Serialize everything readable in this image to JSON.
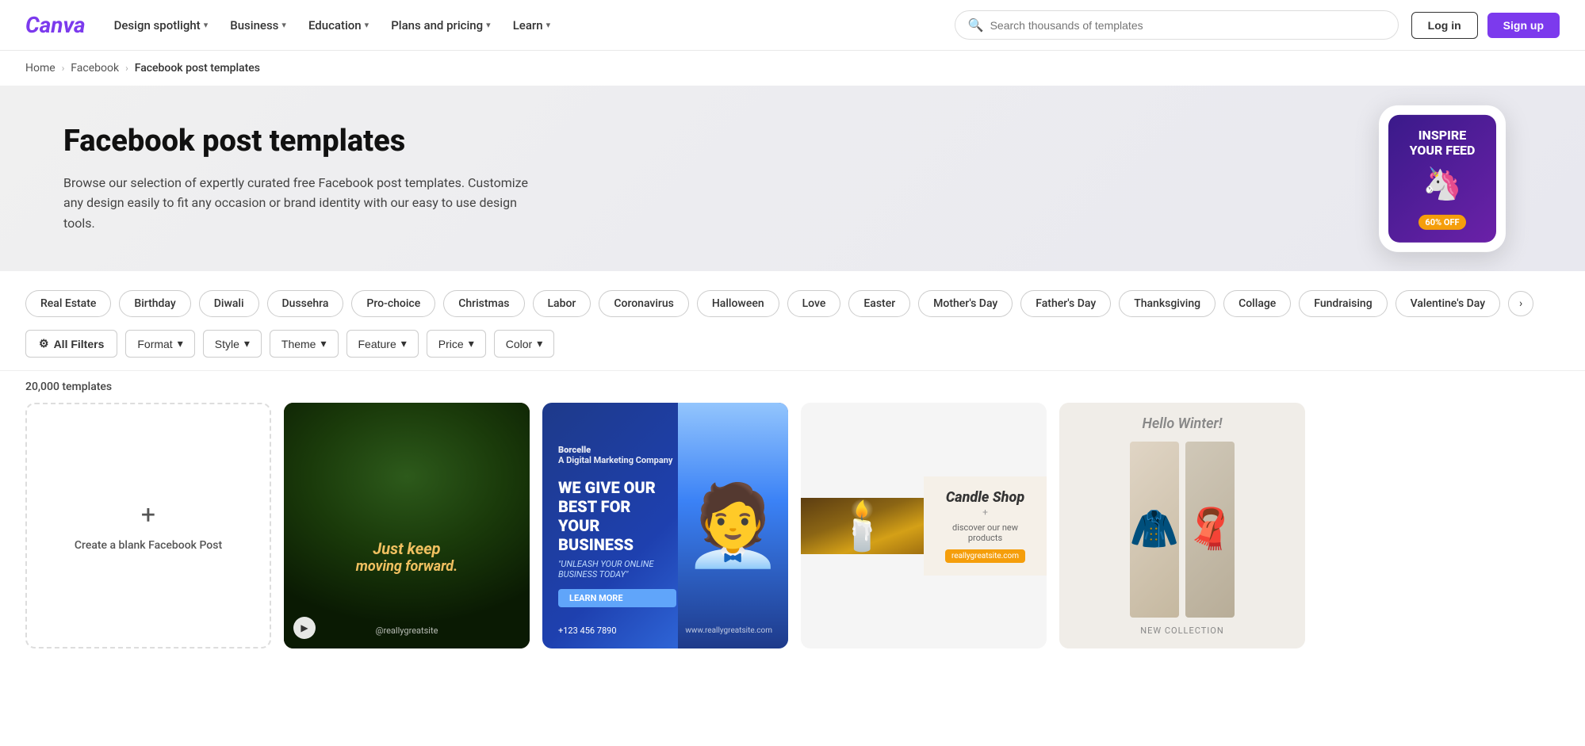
{
  "brand": {
    "name": "Canva",
    "logo_text": "Canva"
  },
  "navbar": {
    "links": [
      {
        "label": "Design spotlight",
        "id": "design-spotlight"
      },
      {
        "label": "Business",
        "id": "business"
      },
      {
        "label": "Education",
        "id": "education"
      },
      {
        "label": "Plans and pricing",
        "id": "plans-pricing"
      },
      {
        "label": "Learn",
        "id": "learn"
      }
    ],
    "search_placeholder": "Search thousands of templates",
    "login_label": "Log in",
    "signup_label": "Sign up"
  },
  "breadcrumb": {
    "items": [
      "Home",
      "Facebook",
      "Facebook post templates"
    ]
  },
  "hero": {
    "title": "Facebook post templates",
    "description": "Browse our selection of expertly curated free Facebook post templates. Customize any design easily to fit any occasion or brand identity with our easy to use design tools.",
    "phone_title": "INSPIRE YOUR FEED",
    "phone_badge": "60% OFF"
  },
  "tags": [
    "Real Estate",
    "Birthday",
    "Diwali",
    "Dussehra",
    "Pro-choice",
    "Christmas",
    "Labor",
    "Coronavirus",
    "Halloween",
    "Love",
    "Easter",
    "Mother's Day",
    "Father's Day",
    "Thanksgiving",
    "Collage",
    "Fundraising",
    "Valentine's Day"
  ],
  "filters": {
    "all_filters_label": "All Filters",
    "buttons": [
      "Format",
      "Style",
      "Theme",
      "Feature",
      "Price",
      "Color"
    ]
  },
  "templates_count": "20,000 templates",
  "blank_card": {
    "label": "Create a blank Facebook Post"
  },
  "cards": [
    {
      "id": "forest",
      "line1": "Just keep",
      "line2": "moving forward.",
      "handle": "@reallygreatsite",
      "has_play": true
    },
    {
      "id": "business",
      "logo": "Borcelle",
      "logo_sub": "A Digital Marketing Company",
      "headline": "WE GIVE OUR BEST FOR YOUR BUSINESS",
      "subline": "\"UNLEASH YOUR ONLINE BUSINESS TODAY\"",
      "cta": "LEARN MORE",
      "phone": "+123 456 7890",
      "url": "www.reallygreatsite.com"
    },
    {
      "id": "candle",
      "shop_name": "Candle Shop",
      "plus": "+",
      "discover": "discover our new products",
      "url": "www.reallygreatsite.com"
    },
    {
      "id": "winter",
      "title": "Hello Winter!",
      "cta": "NEW COLLECTION"
    }
  ]
}
